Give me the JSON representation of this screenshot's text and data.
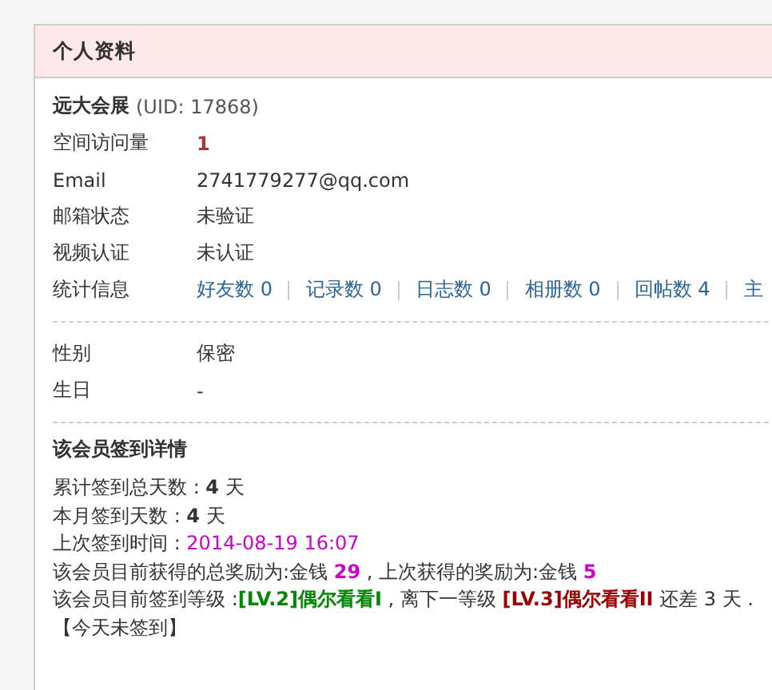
{
  "panel": {
    "title": "个人资料"
  },
  "profile": {
    "name": "远大会展",
    "uid": "(UID: 17868)",
    "rows": [
      {
        "label": "空间访问量",
        "value": "1",
        "kind": "count"
      },
      {
        "label": "Email",
        "value": "2741779277@qq.com",
        "kind": "text"
      },
      {
        "label": "邮箱状态",
        "value": "未验证",
        "kind": "text"
      },
      {
        "label": "视频认证",
        "value": "未认证",
        "kind": "text"
      }
    ],
    "stats": {
      "label": "统计信息",
      "links": [
        "好友数 0",
        "记录数 0",
        "日志数 0",
        "相册数 0",
        "回帖数 4",
        "主"
      ]
    }
  },
  "details": [
    {
      "label": "性别",
      "value": "保密"
    },
    {
      "label": "生日",
      "value": "-"
    }
  ],
  "signin": {
    "title": "该会员签到详情",
    "lines": [
      [
        {
          "kind": "plain",
          "text": "累计签到总天数 : "
        },
        {
          "kind": "bold",
          "text": "4"
        },
        {
          "kind": "plain",
          "text": " 天"
        }
      ],
      [
        {
          "kind": "plain",
          "text": "本月签到天数 : "
        },
        {
          "kind": "bold",
          "text": "4"
        },
        {
          "kind": "plain",
          "text": " 天"
        }
      ],
      [
        {
          "kind": "plain",
          "text": "上次签到时间 : "
        },
        {
          "kind": "date",
          "text": "2014-08-19 16:07"
        }
      ],
      [
        {
          "kind": "plain",
          "text": "该会员目前获得的总奖励为:金钱 "
        },
        {
          "kind": "money",
          "text": "29"
        },
        {
          "kind": "plain",
          "text": " , 上次获得的奖励为:金钱 "
        },
        {
          "kind": "money",
          "text": "5"
        }
      ],
      [
        {
          "kind": "plain",
          "text": "该会员目前签到等级 :"
        },
        {
          "kind": "level",
          "text": "[LV.2]偶尔看看I"
        },
        {
          "kind": "plain",
          "text": " , 离下一等级 "
        },
        {
          "kind": "next",
          "text": "[LV.3]偶尔看看II"
        },
        {
          "kind": "plain",
          "text": " 还差 3 天 ."
        }
      ],
      [
        {
          "kind": "plain",
          "text": "【今天未签到】"
        }
      ]
    ]
  }
}
